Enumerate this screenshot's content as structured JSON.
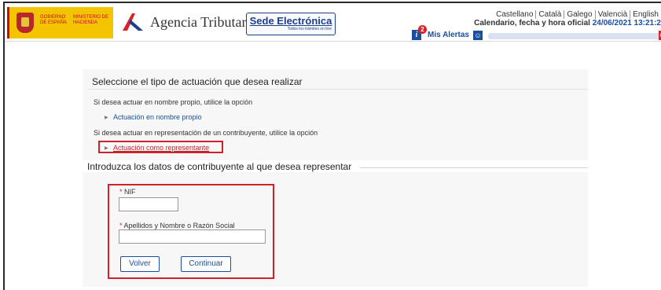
{
  "header": {
    "gobierno_text": "GOBIERNO DE ESPAÑA",
    "ministerio_text": "MINISTERIO DE HACIENDA",
    "agency_title": "Agencia Tributaria",
    "sede_title": "Sede Electrónica",
    "sede_subtitle": "Todos los trámites on line",
    "languages": [
      "Castellano",
      "Català",
      "Galego",
      "Valencià",
      "English"
    ],
    "datetime_label": "Calendario, fecha y hora oficial",
    "datetime_value": "24/06/2021 13:21:2",
    "alerts_count": "2",
    "alerts_label": "Mis Alertas",
    "colors": {
      "accent": "#1a4fa0",
      "brand_red": "#c60b1e",
      "brand_yellow": "#f5c400",
      "highlight_red": "#d0202a"
    }
  },
  "main": {
    "select_title": "Seleccione el tipo de actuación que desea realizar",
    "own_name_text": "Si desea actuar en nombre propio, utilice la opción",
    "own_name_link": "Actuación en nombre propio",
    "representation_text": "Si desea actuar en representación de un contribuyente, utilice la opción",
    "representation_link": "Actuación como representante",
    "section_title": "Introduzca los datos de contribuyente al que desea representar"
  },
  "form": {
    "required_marker": "*",
    "nif_label": "NIF",
    "nif_value": "",
    "name_label": "Apellidos y Nombre o Razón Social",
    "name_value": "",
    "back_button": "Volver",
    "continue_button": "Continuar"
  }
}
